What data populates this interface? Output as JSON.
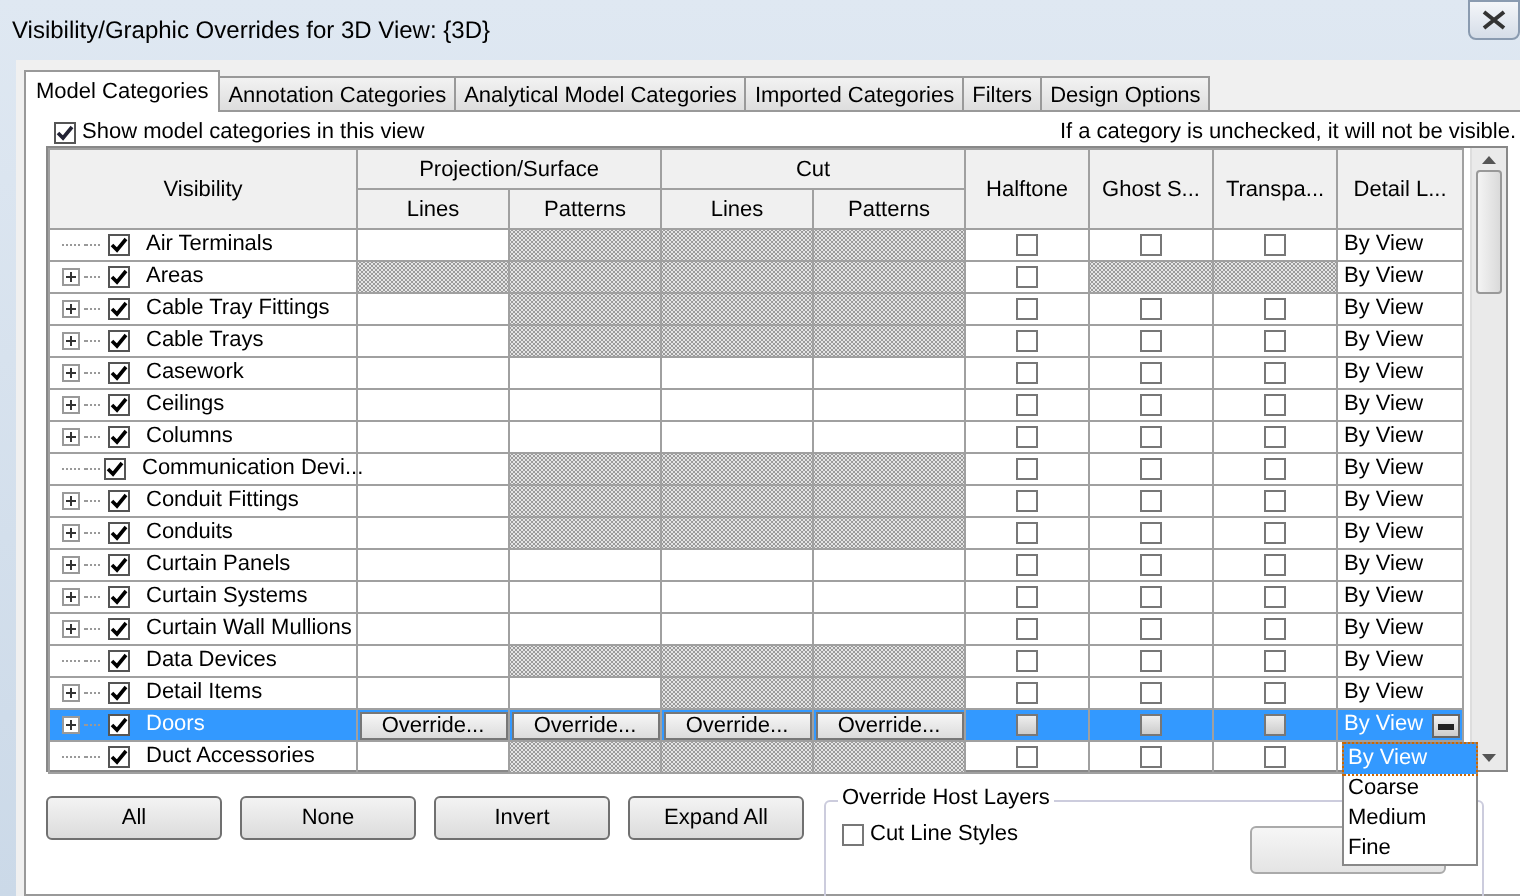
{
  "window": {
    "title": "Visibility/Graphic Overrides for 3D View: {3D}"
  },
  "tabs": [
    {
      "label": "Model Categories",
      "selected": true
    },
    {
      "label": "Annotation Categories",
      "selected": false
    },
    {
      "label": "Analytical Model Categories",
      "selected": false
    },
    {
      "label": "Imported Categories",
      "selected": false
    },
    {
      "label": "Filters",
      "selected": false
    },
    {
      "label": "Design Options",
      "selected": false
    }
  ],
  "show_categories": {
    "label": "Show model categories in this view",
    "checked": true
  },
  "note": "If a category is unchecked, it will not be visible.",
  "table": {
    "visibility_header": "Visibility",
    "groups": [
      "Projection/Surface",
      "Cut"
    ],
    "sub_headers": [
      "Lines",
      "Patterns",
      "Lines",
      "Patterns"
    ],
    "columns": [
      "Halftone",
      "Ghost S...",
      "Transpa...",
      "Detail L..."
    ],
    "rows": [
      {
        "name": "Air Terminals",
        "expandable": false,
        "checked": true,
        "selected": false,
        "cells": [
          {
            "kind": "blank"
          },
          {
            "kind": "hatched"
          },
          {
            "kind": "hatched"
          },
          {
            "kind": "hatched"
          }
        ],
        "flags": [
          {
            "kind": "checkbox",
            "checked": false
          },
          {
            "kind": "checkbox",
            "checked": false
          },
          {
            "kind": "checkbox",
            "checked": false
          }
        ],
        "detail": "By View"
      },
      {
        "name": "Areas",
        "expandable": true,
        "checked": true,
        "selected": false,
        "cells": [
          {
            "kind": "hatched"
          },
          {
            "kind": "hatched"
          },
          {
            "kind": "hatched"
          },
          {
            "kind": "hatched"
          }
        ],
        "flags": [
          {
            "kind": "checkbox",
            "checked": false
          },
          {
            "kind": "hatched"
          },
          {
            "kind": "hatched"
          }
        ],
        "detail": "By View"
      },
      {
        "name": "Cable Tray Fittings",
        "expandable": true,
        "checked": true,
        "selected": false,
        "cells": [
          {
            "kind": "blank"
          },
          {
            "kind": "hatched"
          },
          {
            "kind": "hatched"
          },
          {
            "kind": "hatched"
          }
        ],
        "flags": [
          {
            "kind": "checkbox",
            "checked": false
          },
          {
            "kind": "checkbox",
            "checked": false
          },
          {
            "kind": "checkbox",
            "checked": false
          }
        ],
        "detail": "By View"
      },
      {
        "name": "Cable Trays",
        "expandable": true,
        "checked": true,
        "selected": false,
        "cells": [
          {
            "kind": "blank"
          },
          {
            "kind": "hatched"
          },
          {
            "kind": "hatched"
          },
          {
            "kind": "hatched"
          }
        ],
        "flags": [
          {
            "kind": "checkbox",
            "checked": false
          },
          {
            "kind": "checkbox",
            "checked": false
          },
          {
            "kind": "checkbox",
            "checked": false
          }
        ],
        "detail": "By View"
      },
      {
        "name": "Casework",
        "expandable": true,
        "checked": true,
        "selected": false,
        "cells": [
          {
            "kind": "blank"
          },
          {
            "kind": "blank"
          },
          {
            "kind": "blank"
          },
          {
            "kind": "blank"
          }
        ],
        "flags": [
          {
            "kind": "checkbox",
            "checked": false
          },
          {
            "kind": "checkbox",
            "checked": false
          },
          {
            "kind": "checkbox",
            "checked": false
          }
        ],
        "detail": "By View"
      },
      {
        "name": "Ceilings",
        "expandable": true,
        "checked": true,
        "selected": false,
        "cells": [
          {
            "kind": "blank"
          },
          {
            "kind": "blank"
          },
          {
            "kind": "blank"
          },
          {
            "kind": "blank"
          }
        ],
        "flags": [
          {
            "kind": "checkbox",
            "checked": false
          },
          {
            "kind": "checkbox",
            "checked": false
          },
          {
            "kind": "checkbox",
            "checked": false
          }
        ],
        "detail": "By View"
      },
      {
        "name": "Columns",
        "expandable": true,
        "checked": true,
        "selected": false,
        "cells": [
          {
            "kind": "blank"
          },
          {
            "kind": "blank"
          },
          {
            "kind": "blank"
          },
          {
            "kind": "blank"
          }
        ],
        "flags": [
          {
            "kind": "checkbox",
            "checked": false
          },
          {
            "kind": "checkbox",
            "checked": false
          },
          {
            "kind": "checkbox",
            "checked": false
          }
        ],
        "detail": "By View"
      },
      {
        "name": "Communication Devi...",
        "expandable": false,
        "checked": true,
        "selected": false,
        "cells": [
          {
            "kind": "blank"
          },
          {
            "kind": "hatched"
          },
          {
            "kind": "hatched"
          },
          {
            "kind": "hatched"
          }
        ],
        "flags": [
          {
            "kind": "checkbox",
            "checked": false
          },
          {
            "kind": "checkbox",
            "checked": false
          },
          {
            "kind": "checkbox",
            "checked": false
          }
        ],
        "detail": "By View"
      },
      {
        "name": "Conduit Fittings",
        "expandable": true,
        "checked": true,
        "selected": false,
        "cells": [
          {
            "kind": "blank"
          },
          {
            "kind": "hatched"
          },
          {
            "kind": "hatched"
          },
          {
            "kind": "hatched"
          }
        ],
        "flags": [
          {
            "kind": "checkbox",
            "checked": false
          },
          {
            "kind": "checkbox",
            "checked": false
          },
          {
            "kind": "checkbox",
            "checked": false
          }
        ],
        "detail": "By View"
      },
      {
        "name": "Conduits",
        "expandable": true,
        "checked": true,
        "selected": false,
        "cells": [
          {
            "kind": "blank"
          },
          {
            "kind": "hatched"
          },
          {
            "kind": "hatched"
          },
          {
            "kind": "hatched"
          }
        ],
        "flags": [
          {
            "kind": "checkbox",
            "checked": false
          },
          {
            "kind": "checkbox",
            "checked": false
          },
          {
            "kind": "checkbox",
            "checked": false
          }
        ],
        "detail": "By View"
      },
      {
        "name": "Curtain Panels",
        "expandable": true,
        "checked": true,
        "selected": false,
        "cells": [
          {
            "kind": "blank"
          },
          {
            "kind": "blank"
          },
          {
            "kind": "blank"
          },
          {
            "kind": "blank"
          }
        ],
        "flags": [
          {
            "kind": "checkbox",
            "checked": false
          },
          {
            "kind": "checkbox",
            "checked": false
          },
          {
            "kind": "checkbox",
            "checked": false
          }
        ],
        "detail": "By View"
      },
      {
        "name": "Curtain Systems",
        "expandable": true,
        "checked": true,
        "selected": false,
        "cells": [
          {
            "kind": "blank"
          },
          {
            "kind": "blank"
          },
          {
            "kind": "blank"
          },
          {
            "kind": "blank"
          }
        ],
        "flags": [
          {
            "kind": "checkbox",
            "checked": false
          },
          {
            "kind": "checkbox",
            "checked": false
          },
          {
            "kind": "checkbox",
            "checked": false
          }
        ],
        "detail": "By View"
      },
      {
        "name": "Curtain Wall Mullions",
        "expandable": true,
        "checked": true,
        "selected": false,
        "cells": [
          {
            "kind": "blank"
          },
          {
            "kind": "blank"
          },
          {
            "kind": "blank"
          },
          {
            "kind": "blank"
          }
        ],
        "flags": [
          {
            "kind": "checkbox",
            "checked": false
          },
          {
            "kind": "checkbox",
            "checked": false
          },
          {
            "kind": "checkbox",
            "checked": false
          }
        ],
        "detail": "By View"
      },
      {
        "name": "Data Devices",
        "expandable": false,
        "checked": true,
        "selected": false,
        "cells": [
          {
            "kind": "blank"
          },
          {
            "kind": "hatched"
          },
          {
            "kind": "hatched"
          },
          {
            "kind": "hatched"
          }
        ],
        "flags": [
          {
            "kind": "checkbox",
            "checked": false
          },
          {
            "kind": "checkbox",
            "checked": false
          },
          {
            "kind": "checkbox",
            "checked": false
          }
        ],
        "detail": "By View"
      },
      {
        "name": "Detail Items",
        "expandable": true,
        "checked": true,
        "selected": false,
        "cells": [
          {
            "kind": "blank"
          },
          {
            "kind": "blank"
          },
          {
            "kind": "hatched"
          },
          {
            "kind": "hatched"
          }
        ],
        "flags": [
          {
            "kind": "checkbox",
            "checked": false
          },
          {
            "kind": "checkbox",
            "checked": false
          },
          {
            "kind": "checkbox",
            "checked": false
          }
        ],
        "detail": "By View"
      },
      {
        "name": "Doors",
        "expandable": true,
        "checked": true,
        "selected": true,
        "cells": [
          {
            "kind": "button",
            "label": "Override..."
          },
          {
            "kind": "button",
            "label": "Override..."
          },
          {
            "kind": "button",
            "label": "Override..."
          },
          {
            "kind": "button",
            "label": "Override..."
          }
        ],
        "flags": [
          {
            "kind": "checkbox",
            "checked": false
          },
          {
            "kind": "checkbox",
            "checked": false
          },
          {
            "kind": "checkbox",
            "checked": false
          }
        ],
        "detail": "By View",
        "dropdown": [
          {
            "label": "By View",
            "selected": true
          },
          {
            "label": "Coarse",
            "selected": false
          },
          {
            "label": "Medium",
            "selected": false
          },
          {
            "label": "Fine",
            "selected": false
          }
        ]
      },
      {
        "name": "Duct Accessories",
        "expandable": false,
        "checked": true,
        "selected": false,
        "cells": [
          {
            "kind": "blank"
          },
          {
            "kind": "hatched"
          },
          {
            "kind": "hatched"
          },
          {
            "kind": "hatched"
          }
        ],
        "flags": [
          {
            "kind": "checkbox",
            "checked": false
          },
          {
            "kind": "checkbox",
            "checked": false
          },
          {
            "kind": "checkbox",
            "checked": false
          }
        ]
      }
    ]
  },
  "buttons": [
    "All",
    "None",
    "Invert",
    "Expand All"
  ],
  "host_layers": {
    "title": "Override Host Layers",
    "cut_line_styles": {
      "label": "Cut Line Styles",
      "checked": false
    }
  }
}
